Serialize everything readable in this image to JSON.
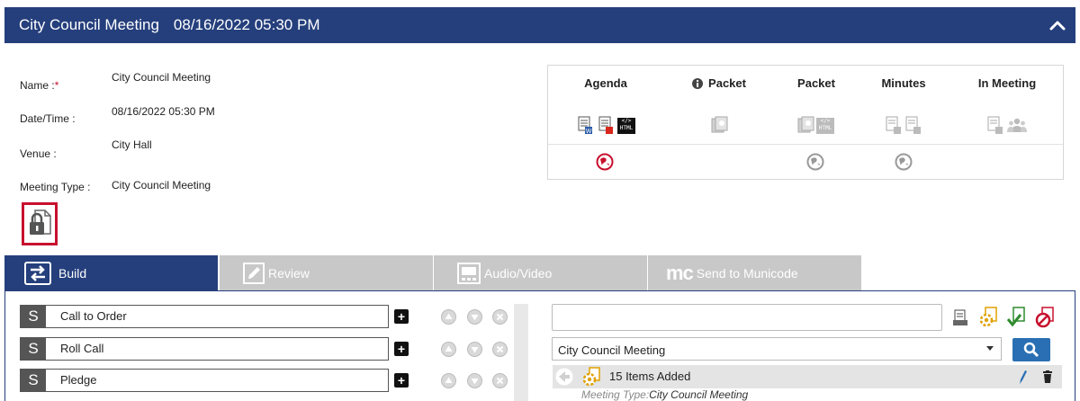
{
  "header": {
    "title": "City Council Meeting",
    "datetime": "08/16/2022 05:30 PM"
  },
  "info": {
    "name_label": "Name :",
    "name_required": "*",
    "name_value": "City Council Meeting",
    "datetime_label": "Date/Time :",
    "datetime_value": "08/16/2022 05:30 PM",
    "venue_label": "Venue :",
    "venue_value": "City Hall",
    "type_label": "Meeting Type :",
    "type_value": "City Council Meeting"
  },
  "publish_grid": {
    "columns": [
      "Agenda",
      "Packet",
      "Packet",
      "Minutes",
      "In Meeting"
    ],
    "html_tag": "HTML"
  },
  "tabs": [
    {
      "label": "Build"
    },
    {
      "label": "Review"
    },
    {
      "label": "Audio/Video"
    },
    {
      "label": "Send to Municode",
      "logo": "mc"
    }
  ],
  "agenda_items": [
    {
      "badge": "S",
      "label": "Call to Order"
    },
    {
      "badge": "S",
      "label": "Roll Call"
    },
    {
      "badge": "S",
      "label": "Pledge"
    }
  ],
  "right_panel": {
    "search_value": "",
    "meeting_select": "City Council Meeting",
    "items_added": "15 Items Added",
    "meta_label": "Meeting Type:",
    "meta_value": "City Council Meeting"
  },
  "colors": {
    "header_bg": "#253f7c",
    "accent_red": "#c8102e",
    "tab_inactive": "#c8c8c8",
    "search_button": "#2a6fb3"
  }
}
